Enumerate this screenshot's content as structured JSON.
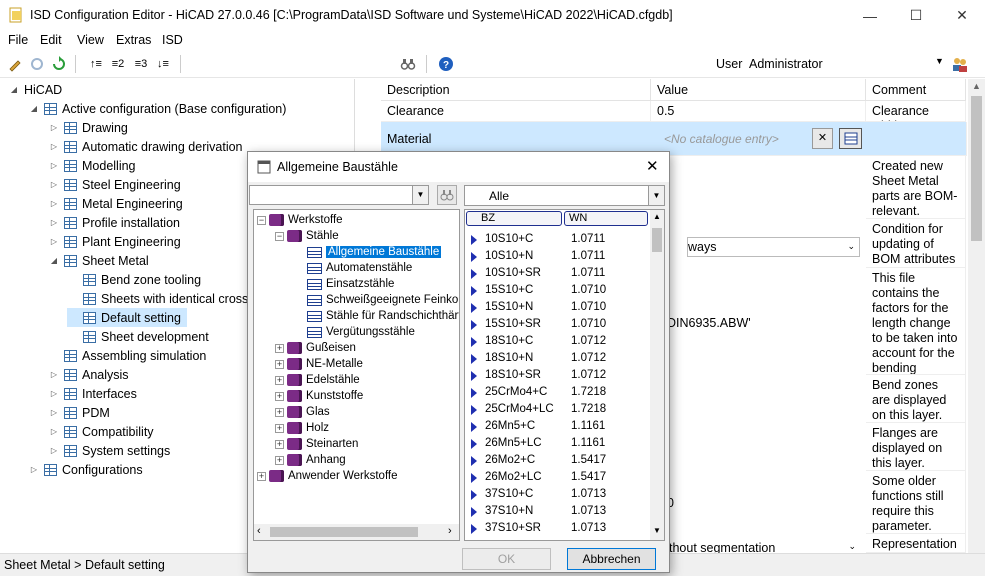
{
  "window": {
    "title": "ISD Configuration Editor  - HiCAD 27.0.0.46 [C:\\ProgramData\\ISD Software und Systeme\\HiCAD 2022\\HiCAD.cfgdb]",
    "min": "—",
    "max": "☐",
    "close": "✕"
  },
  "menu": [
    "File",
    "Edit",
    "View",
    "Extras",
    "ISD"
  ],
  "toolbar": {
    "user_label": "User",
    "user_value": "Administrator"
  },
  "tree": {
    "root": "HiCAD",
    "active": "Active configuration (Base configuration)",
    "items": [
      "Drawing",
      "Automatic drawing derivation",
      "Modelling",
      "Steel Engineering",
      "Metal Engineering",
      "Profile installation",
      "Plant Engineering",
      "Sheet Metal"
    ],
    "sheet_children": [
      "Bend zone tooling",
      "Sheets with identical cross-sections",
      "Default setting",
      "Sheet development"
    ],
    "after": [
      "Assembling simulation",
      "Analysis",
      "Interfaces",
      "PDM",
      "Compatibility",
      "System settings"
    ],
    "configurations": "Configurations"
  },
  "grid": {
    "headers": [
      "Description",
      "Value",
      "Comment"
    ],
    "rows": [
      {
        "desc": "Clearance",
        "value": "0.5",
        "comment": "Clearance width"
      },
      {
        "desc": "Material",
        "value": "<No catalogue entry>",
        "comment": ""
      }
    ],
    "partial_values": [
      "ways",
      "DIN6935.ABW'",
      "0",
      "thout segmentation"
    ],
    "comments": [
      "Created new Sheet Metal parts are BOM-relevant.",
      "Condition for updating of BOM attributes",
      "This file contains the factors for the length change to be taken into account for the bending",
      "Bend zones are displayed on this layer.",
      "Flanges are displayed on this layer.",
      "Some older functions still require this parameter.",
      "Representation of"
    ]
  },
  "status": "Sheet Metal > Default setting",
  "dialog": {
    "title": "Allgemeine Baustähle",
    "filter_value": "Alle",
    "tree": {
      "root": "Werkstoffe",
      "staehle": "Stähle",
      "steel_children": [
        "Allgemeine Baustähle",
        "Automatenstähle",
        "Einsatzstähle",
        "Schweißgeeignete Feinkornbaustähle",
        "Stähle für Randschichthärtung",
        "Vergütungsstähle"
      ],
      "groups": [
        "Gußeisen",
        "NE-Metalle",
        "Edelstähle",
        "Kunststoffe",
        "Glas",
        "Holz",
        "Steinarten",
        "Anhang"
      ],
      "user": "Anwender Werkstoffe"
    },
    "list_headers": [
      "BZ",
      "WN"
    ],
    "materials": [
      [
        "10S10+C",
        "1.0711"
      ],
      [
        "10S10+N",
        "1.0711"
      ],
      [
        "10S10+SR",
        "1.0711"
      ],
      [
        "15S10+C",
        "1.0710"
      ],
      [
        "15S10+N",
        "1.0710"
      ],
      [
        "15S10+SR",
        "1.0710"
      ],
      [
        "18S10+C",
        "1.0712"
      ],
      [
        "18S10+N",
        "1.0712"
      ],
      [
        "18S10+SR",
        "1.0712"
      ],
      [
        "25CrMo4+C",
        "1.7218"
      ],
      [
        "25CrMo4+LC",
        "1.7218"
      ],
      [
        "26Mn5+C",
        "1.1161"
      ],
      [
        "26Mn5+LC",
        "1.1161"
      ],
      [
        "26Mo2+C",
        "1.5417"
      ],
      [
        "26Mo2+LC",
        "1.5417"
      ],
      [
        "37S10+C",
        "1.0713"
      ],
      [
        "37S10+N",
        "1.0713"
      ],
      [
        "37S10+SR",
        "1.0713"
      ]
    ],
    "ok": "OK",
    "cancel": "Abbrechen"
  }
}
